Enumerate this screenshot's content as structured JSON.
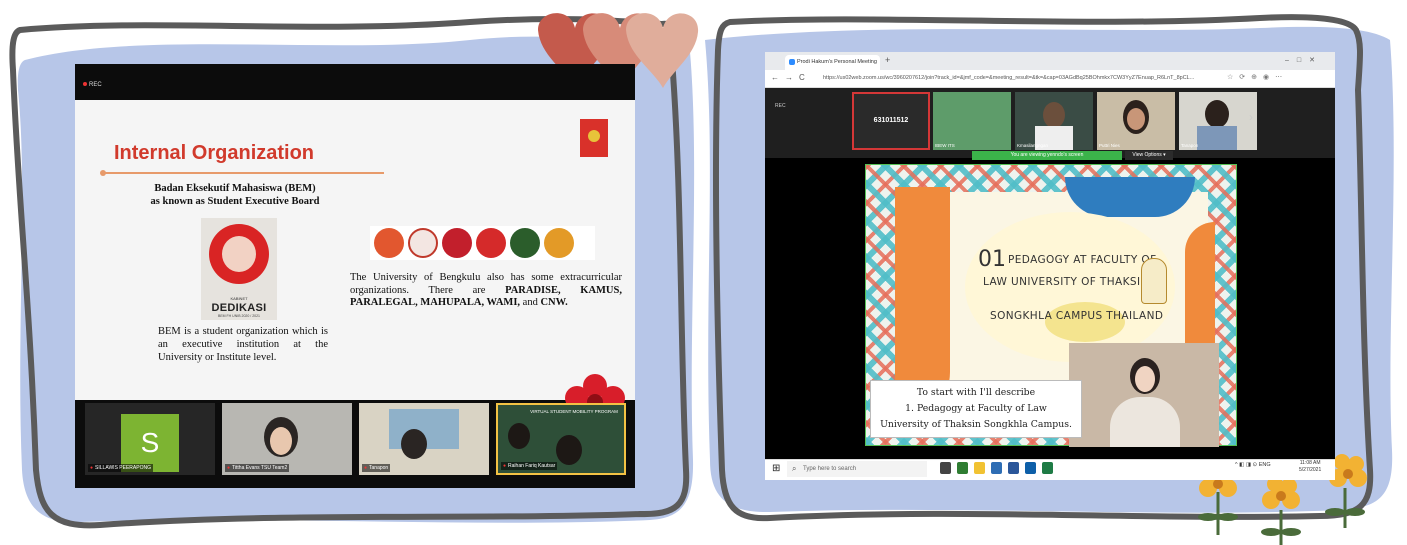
{
  "left": {
    "rec_label": "REC",
    "slide_title": "Internal Organization",
    "bem_heading_line1": "Badan Eksekutif Mahasiswa (BEM)",
    "bem_heading_line2": "as known as Student Executive Board",
    "bem_logo_kabinet": "KABINET",
    "bem_logo_name": "DEDIKASI",
    "bem_logo_sub": "BEM FH UNIB 2020 / 2021",
    "bem_description": "BEM is a student organization which is an executive institution at the University or Institute level.",
    "uni_text_plain": "The University of Bengkulu also has some extracurricular organizations. There are ",
    "uni_text_bold": "PARADISE, KAMUS, PARALEGAL, MAHUPALA, WAMI,",
    "uni_text_and": " and ",
    "uni_text_cnw": "CNW.",
    "participants": [
      {
        "name": "SILLAWIS PEERAPONG",
        "avatar_letter": "S"
      },
      {
        "name": "Tittha Evans TSU Team2"
      },
      {
        "name": "Tanapon"
      },
      {
        "name": "Raihan Fariq Kautsar",
        "share_banner": "VIRTUAL STUDENT MOBILITY PROGRAM"
      }
    ]
  },
  "right": {
    "browser_tab": "Prodi Hakum's Personal Meeting",
    "url": "https://us02web.zoom.us/wc/3960207612/join?track_id=&jmf_code=&meeting_result=&tk=&cap=03AGdBq25BOhmkx7CW3YyZ7Enuap_R6LnT_8pCL...",
    "rec_label": "REC",
    "meeting_id": "631011512",
    "thumbs": [
      {
        "name": "IBEW ITS"
      },
      {
        "name": "Kmasilangngan"
      },
      {
        "name": "Puttri Nies"
      },
      {
        "name": "Tanapon"
      }
    ],
    "viewing_notice": "You are viewing yenndo's screen",
    "view_options": "View Options",
    "slide_number": "01",
    "slide_line1": "PEDAGOGY AT FACULTY OF",
    "slide_line2": "LAW UNIVERSITY OF THAKSIN",
    "slide_line3": "SONGKHLA CAMPUS  THAILAND",
    "caption_line1": "To start  with I'll describe",
    "caption_line2": "1. Pedagogy at Faculty of Law",
    "caption_line3": "University of Thaksin Songkhla Campus.",
    "taskbar_search": "Type here to search",
    "tray_lang": "ENG",
    "clock_time": "11:08 AM",
    "clock_date": "5/27/2021"
  },
  "colors": {
    "frame_fill": "#b7c6e8",
    "frame_stroke": "#5b5b5b",
    "slide_title": "#d13a2c",
    "hearts": [
      "#c45a4c",
      "#d78b79",
      "#e0ad9b"
    ],
    "flower": "#f2b233",
    "leaf": "#4a6b3a"
  }
}
